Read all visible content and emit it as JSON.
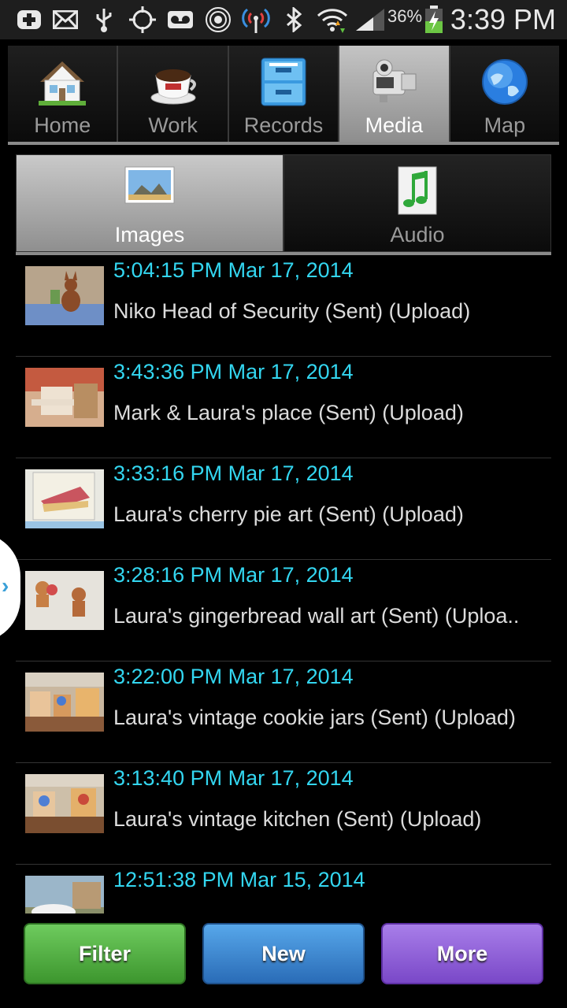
{
  "status_bar": {
    "battery": "36%",
    "time": "3:39 PM",
    "icons": [
      "add-icon",
      "mail-icon",
      "usb-icon",
      "gps-icon",
      "voicemail-icon",
      "nfc-icon",
      "signal-tower-icon",
      "bluetooth-icon",
      "wifi-icon",
      "cell-signal-icon",
      "battery-charging-icon"
    ]
  },
  "main_tabs": [
    {
      "label": "Home",
      "icon": "house-icon"
    },
    {
      "label": "Work",
      "icon": "coffee-cup-icon"
    },
    {
      "label": "Records",
      "icon": "file-cabinet-icon"
    },
    {
      "label": "Media",
      "icon": "video-camera-icon",
      "active": true
    },
    {
      "label": "Map",
      "icon": "globe-icon"
    }
  ],
  "sub_tabs": [
    {
      "label": "Images",
      "icon": "picture-icon",
      "active": true
    },
    {
      "label": "Audio",
      "icon": "music-note-icon"
    }
  ],
  "items": [
    {
      "timestamp": "5:04:15 PM Mar 17, 2014",
      "title": "Niko Head of Security (Sent) (Upload)"
    },
    {
      "timestamp": "3:43:36 PM Mar 17, 2014",
      "title": "Mark & Laura's place (Sent) (Upload)"
    },
    {
      "timestamp": "3:33:16 PM Mar 17, 2014",
      "title": "Laura's cherry pie art (Sent) (Upload)"
    },
    {
      "timestamp": "3:28:16 PM Mar 17, 2014",
      "title": "Laura's gingerbread wall art (Sent) (Uploa.."
    },
    {
      "timestamp": "3:22:00 PM Mar 17, 2014",
      "title": "Laura's vintage cookie jars (Sent) (Upload)"
    },
    {
      "timestamp": "3:13:40 PM Mar 17, 2014",
      "title": "Laura's vintage kitchen (Sent) (Upload)"
    },
    {
      "timestamp": "12:51:38 PM Mar 15, 2014",
      "title": ""
    }
  ],
  "buttons": {
    "filter": "Filter",
    "new": "New",
    "more": "More"
  },
  "colors": {
    "timestamp": "#33d6f0",
    "filter": "#4fae3f",
    "new": "#3a86d4",
    "more": "#8d5cd9"
  }
}
